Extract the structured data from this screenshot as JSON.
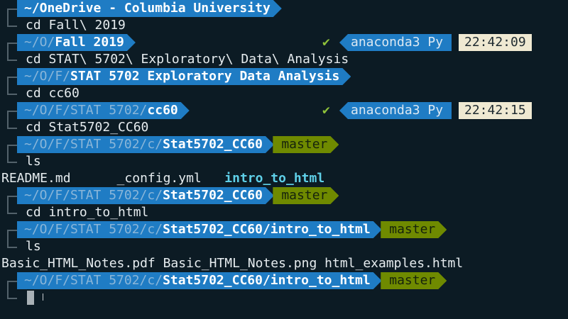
{
  "terminal": {
    "lines": [
      {
        "type": "prompt",
        "dir_dim": "",
        "dir_bold": "~/OneDrive - Columbia University",
        "git": ""
      },
      {
        "type": "cmd",
        "text": "cd Fall\\ 2019"
      },
      {
        "type": "prompt",
        "dir_dim": "~/O/",
        "dir_bold": "Fall 2019",
        "git": "",
        "right": {
          "check": "✔",
          "env": "anaconda3 Py",
          "time": "22:42:09"
        }
      },
      {
        "type": "cmd",
        "text": "cd STAT\\ 5702\\ Exploratory\\ Data\\ Analysis"
      },
      {
        "type": "prompt",
        "dir_dim": "~/O/F/",
        "dir_bold": "STAT 5702 Exploratory Data Analysis",
        "git": ""
      },
      {
        "type": "cmd",
        "text": "cd cc60"
      },
      {
        "type": "prompt",
        "dir_dim": "~/O/F/STAT 5702/",
        "dir_bold": "cc60",
        "git": "",
        "right": {
          "check": "✔",
          "env": "anaconda3 Py",
          "time": "22:42:15"
        }
      },
      {
        "type": "cmd",
        "text": "cd Stat5702_CC60"
      },
      {
        "type": "prompt",
        "dir_dim": "~/O/F/STAT 5702/c/",
        "dir_bold": "Stat5702_CC60",
        "git": "master"
      },
      {
        "type": "cmd",
        "text": "ls"
      },
      {
        "type": "out",
        "plain": "README.md      _config.yml   ",
        "dir": "intro_to_html"
      },
      {
        "type": "prompt",
        "dir_dim": "~/O/F/STAT 5702/c/",
        "dir_bold": "Stat5702_CC60",
        "git": "master"
      },
      {
        "type": "cmd",
        "text": "cd intro_to_html"
      },
      {
        "type": "prompt",
        "dir_dim": "~/O/F/STAT 5702/c/",
        "dir_bold": "Stat5702_CC60/intro_to_html",
        "git": "master"
      },
      {
        "type": "cmd",
        "text": "ls"
      },
      {
        "type": "out",
        "plain": "Basic_HTML_Notes.pdf Basic_HTML_Notes.png html_examples.html",
        "dir": ""
      },
      {
        "type": "prompt",
        "dir_dim": "~/O/F/STAT 5702/c/",
        "dir_bold": "Stat5702_CC60/intro_to_html",
        "git": "master"
      },
      {
        "type": "input"
      }
    ]
  }
}
